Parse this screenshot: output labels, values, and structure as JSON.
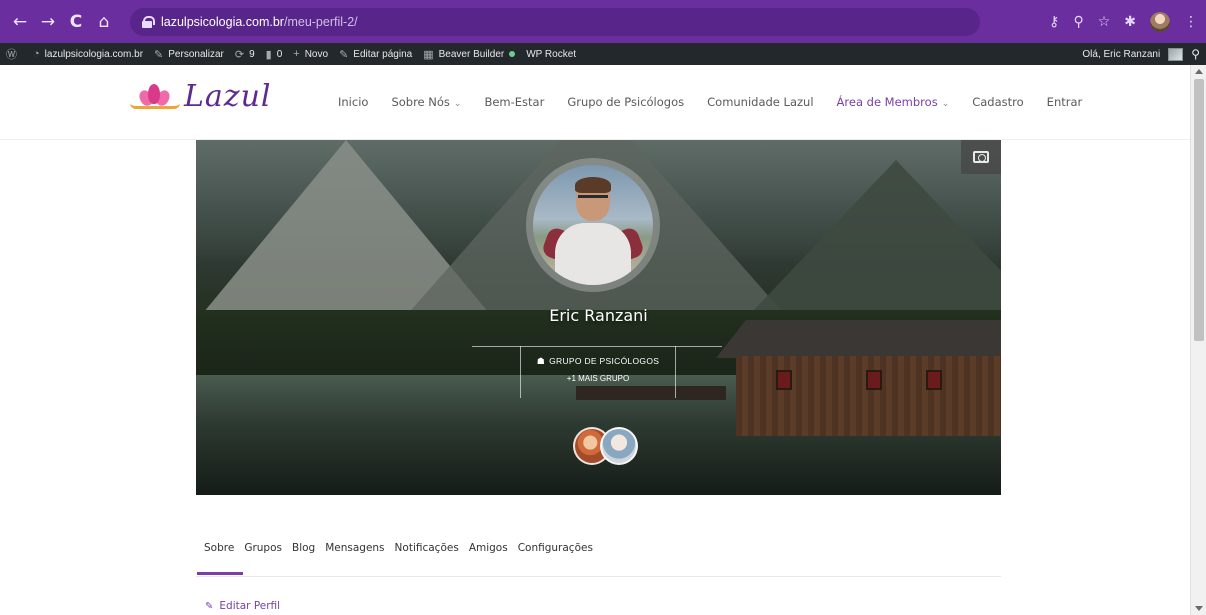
{
  "browser": {
    "nav": {
      "back": "←",
      "forward": "→",
      "reload": "C",
      "home": "⌂"
    },
    "url_host": "lazulpsicologia.com.br",
    "url_path": "/meu-perfil-2/",
    "icons": [
      "key-icon",
      "zoom-icon",
      "star-icon",
      "extensions-icon",
      "profile-avatar",
      "menu-icon"
    ],
    "right_glyphs": {
      "key": "⚷",
      "zoom": "⚲",
      "star": "☆",
      "ext": "✱",
      "menu": "⋮"
    }
  },
  "adminbar": {
    "wp_logo": "W",
    "site": "lazulpsicologia.com.br",
    "customize": "Personalizar",
    "updates": "9",
    "comments": "0",
    "new": "Novo",
    "edit_page": "Editar página",
    "beaver": "Beaver Builder",
    "rocket": "WP Rocket",
    "greeting": "Olá, Eric Ranzani",
    "search_glyph": "⚲",
    "glyphs": {
      "wp": "Ⓦ",
      "dashboard": "◔",
      "brush": "✎",
      "updates": "⟳",
      "comments": "▮",
      "new": "+",
      "edit": "✎",
      "beaver": "▦"
    }
  },
  "site": {
    "logo_text": "Lazul",
    "menu": [
      {
        "label": "Inicio",
        "caret": ""
      },
      {
        "label": "Sobre Nós",
        "caret": "⌄"
      },
      {
        "label": "Bem-Estar",
        "caret": ""
      },
      {
        "label": "Grupo de Psicólogos",
        "caret": ""
      },
      {
        "label": "Comunidade Lazul",
        "caret": ""
      },
      {
        "label": "Área de Membros",
        "caret": "⌄"
      },
      {
        "label": "Cadastro",
        "caret": ""
      },
      {
        "label": "Entrar",
        "caret": ""
      }
    ]
  },
  "profile": {
    "name": "Eric Ranzani",
    "group_name": "GRUPO DE PSICÓLOGOS",
    "group_more": "+1 MAIS GRUPO",
    "group_glyph": "☗",
    "tabs": [
      "Sobre",
      "Grupos",
      "Blog",
      "Mensagens",
      "Notificações",
      "Amigos",
      "Configurações"
    ],
    "edit_profile": "Editar Perfil",
    "edit_glyph": "✎"
  },
  "colors": {
    "chrome": "#6a2e9e",
    "adminbar": "#23282d",
    "accent": "#7a3ea6"
  }
}
